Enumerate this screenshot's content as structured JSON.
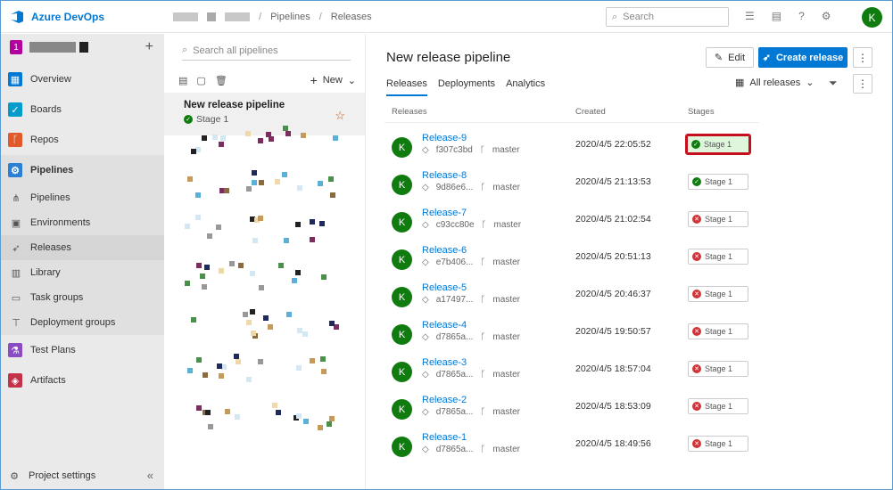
{
  "app": {
    "title": "Azure DevOps"
  },
  "breadcrumb": {
    "pipelines": "Pipelines",
    "releases": "Releases"
  },
  "search": {
    "placeholder": "Search"
  },
  "user": {
    "initial": "K"
  },
  "project": {
    "badge": "1"
  },
  "nav": {
    "items": [
      {
        "label": "Overview",
        "icon": "overview-icon",
        "color": "#0078d4"
      },
      {
        "label": "Boards",
        "icon": "boards-icon",
        "color": "#009ccc"
      },
      {
        "label": "Repos",
        "icon": "repos-icon",
        "color": "#e05a2b"
      },
      {
        "label": "Pipelines",
        "icon": "pipelines-icon",
        "color": "#2b7fd4"
      },
      {
        "label": "Pipelines",
        "icon": "pipeline-sub-icon"
      },
      {
        "label": "Environments",
        "icon": "environments-icon"
      },
      {
        "label": "Releases",
        "icon": "rocket-icon"
      },
      {
        "label": "Library",
        "icon": "library-icon"
      },
      {
        "label": "Task groups",
        "icon": "task-groups-icon"
      },
      {
        "label": "Deployment groups",
        "icon": "deployment-groups-icon"
      },
      {
        "label": "Test Plans",
        "icon": "test-plans-icon",
        "color": "#8a4bc4"
      },
      {
        "label": "Artifacts",
        "icon": "artifacts-icon",
        "color": "#c4314b"
      }
    ],
    "settings": "Project settings"
  },
  "pipelines_panel": {
    "search_placeholder": "Search all pipelines",
    "new_label": "New",
    "selected": {
      "name": "New release pipeline",
      "stage": "Stage 1"
    }
  },
  "main": {
    "title": "New release pipeline",
    "edit_label": "Edit",
    "create_label": "Create release",
    "tabs": [
      "Releases",
      "Deployments",
      "Analytics"
    ],
    "filter_label": "All releases",
    "columns": [
      "Releases",
      "Created",
      "Stages"
    ],
    "rows": [
      {
        "name": "Release-9",
        "commit": "f307c3bd",
        "branch": "master",
        "created": "2020/4/5 22:05:52",
        "stage": "Stage 1",
        "status": "success",
        "highlight": true
      },
      {
        "name": "Release-8",
        "commit": "9d86e6...",
        "branch": "master",
        "created": "2020/4/5 21:13:53",
        "stage": "Stage 1",
        "status": "success",
        "highlight": false
      },
      {
        "name": "Release-7",
        "commit": "c93cc80e",
        "branch": "master",
        "created": "2020/4/5 21:02:54",
        "stage": "Stage 1",
        "status": "failed",
        "highlight": false
      },
      {
        "name": "Release-6",
        "commit": "e7b406...",
        "branch": "master",
        "created": "2020/4/5 20:51:13",
        "stage": "Stage 1",
        "status": "failed",
        "highlight": false
      },
      {
        "name": "Release-5",
        "commit": "a17497...",
        "branch": "master",
        "created": "2020/4/5 20:46:37",
        "stage": "Stage 1",
        "status": "failed",
        "highlight": false
      },
      {
        "name": "Release-4",
        "commit": "d7865a...",
        "branch": "master",
        "created": "2020/4/5 19:50:57",
        "stage": "Stage 1",
        "status": "failed",
        "highlight": false
      },
      {
        "name": "Release-3",
        "commit": "d7865a...",
        "branch": "master",
        "created": "2020/4/5 18:57:04",
        "stage": "Stage 1",
        "status": "failed",
        "highlight": false
      },
      {
        "name": "Release-2",
        "commit": "d7865a...",
        "branch": "master",
        "created": "2020/4/5 18:53:09",
        "stage": "Stage 1",
        "status": "failed",
        "highlight": false
      },
      {
        "name": "Release-1",
        "commit": "d7865a...",
        "branch": "master",
        "created": "2020/4/5 18:49:56",
        "stage": "Stage 1",
        "status": "failed",
        "highlight": false
      }
    ]
  }
}
